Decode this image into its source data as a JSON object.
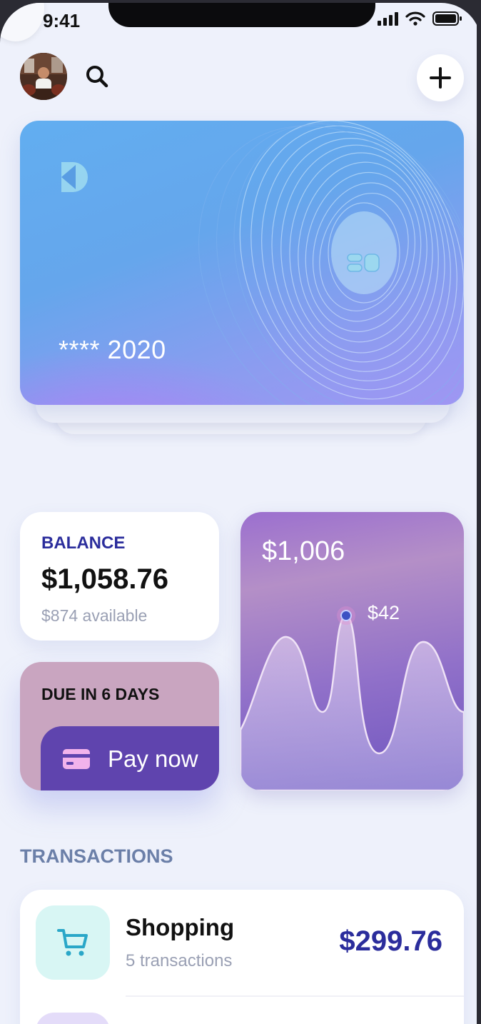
{
  "status_bar": {
    "time": "9:41"
  },
  "header": {
    "avatar_alt": "user-avatar"
  },
  "card": {
    "number": "**** 2020"
  },
  "balance": {
    "label": "BALANCE",
    "value": "$1,058.76",
    "available": "$874 available"
  },
  "due": {
    "label": "DUE IN 6 DAYS",
    "pay_label": "Pay now"
  },
  "spending": {
    "total": "$1,006",
    "point_label": "$42"
  },
  "transactions": {
    "section_title": "TRANSACTIONS",
    "items": [
      {
        "title": "Shopping",
        "subtitle": "5 transactions",
        "amount": "$299.76",
        "icon": "cart-icon"
      }
    ]
  },
  "colors": {
    "accent": "#2b2d9c",
    "pay_button": "#5f44ae",
    "background": "#eef1fb"
  }
}
